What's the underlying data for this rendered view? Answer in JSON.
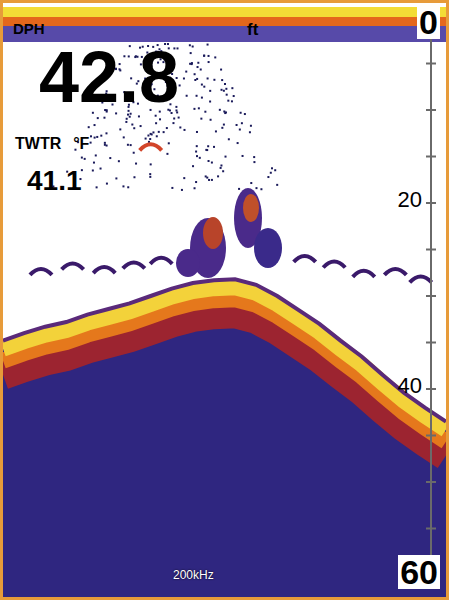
{
  "depth": {
    "label": "DPH",
    "value": "42.8",
    "unit": "ft"
  },
  "water_temp": {
    "label": "TWTR",
    "unit": "°F",
    "value": "41.1"
  },
  "scale": {
    "ticks": [
      "0",
      "20",
      "40",
      "60"
    ],
    "min": 0,
    "max": 60
  },
  "frequency": "200kHz",
  "sonar": {
    "bottom_depths_ft": [
      34.8,
      34,
      33.3,
      32.8,
      32,
      31.4,
      30.8,
      30,
      29.2,
      28.6,
      28.3,
      28.2,
      28.8,
      30,
      31.5,
      33,
      34.8,
      36.5,
      38.5,
      40.4,
      42,
      43.5
    ],
    "fish": [
      {
        "ping": 1.8,
        "depth": 27.2
      },
      {
        "ping": 3.3,
        "depth": 26.6
      },
      {
        "ping": 4.8,
        "depth": 27
      },
      {
        "ping": 6.2,
        "depth": 26.5
      },
      {
        "ping": 7.5,
        "depth": 26
      },
      {
        "ping": 14.3,
        "depth": 25.8
      },
      {
        "ping": 15.7,
        "depth": 26.4
      },
      {
        "ping": 17.1,
        "depth": 27.4
      },
      {
        "ping": 18.6,
        "depth": 27.2
      },
      {
        "ping": 19.8,
        "depth": 28
      },
      {
        "ping": 7.0,
        "depth": 13.8,
        "color": "#d2452a"
      }
    ]
  }
}
